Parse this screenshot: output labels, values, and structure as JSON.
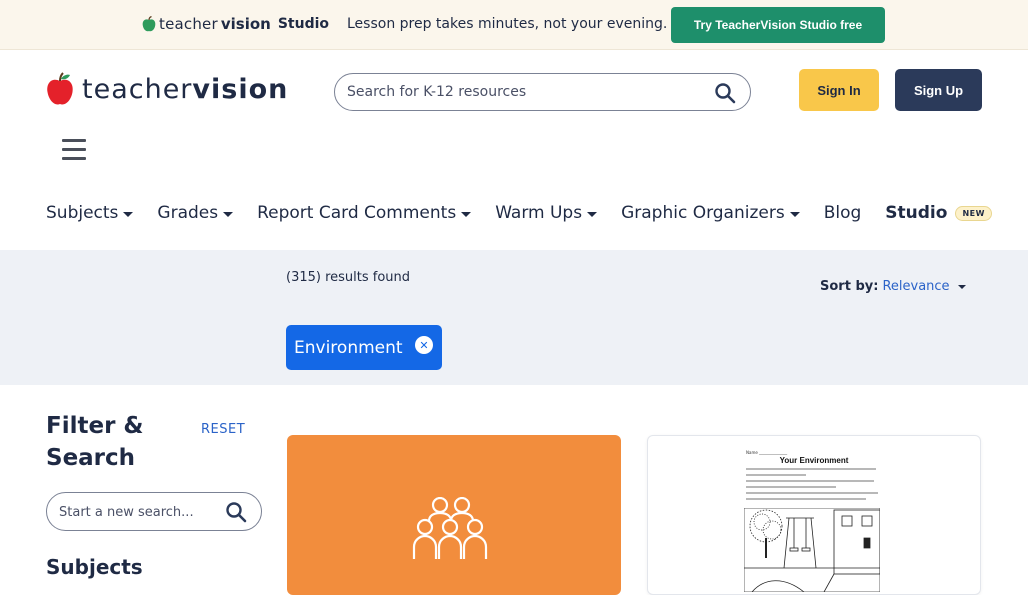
{
  "promo": {
    "logo_word1": "teacher",
    "logo_word2": "vision",
    "logo_word3": "Studio",
    "text": "Lesson prep takes minutes, not your evening.",
    "cta_label": "Try TeacherVision Studio free"
  },
  "header": {
    "logo_word1": "teacher",
    "logo_word2": "vision",
    "search_placeholder": "Search for K-12 resources",
    "signin_label": "Sign In",
    "signup_label": "Sign Up"
  },
  "nav": {
    "items": [
      {
        "label": "Subjects"
      },
      {
        "label": "Grades"
      },
      {
        "label": "Report Card Comments"
      },
      {
        "label": "Warm Ups"
      },
      {
        "label": "Graphic Organizers"
      },
      {
        "label": "Blog"
      },
      {
        "label": "Studio"
      }
    ],
    "badge": "NEW"
  },
  "results": {
    "count_text": "(315) results found",
    "sort_label": "Sort by:",
    "sort_value": "Relevance",
    "chip_label": "Environment"
  },
  "sidebar": {
    "title": "Filter & Search",
    "reset_label": "RESET",
    "search_placeholder": "Start a new search...",
    "subjects_heading": "Subjects"
  },
  "cards": [
    {
      "icon": "group-people-icon",
      "color": "#f28d3d"
    },
    {
      "worksheet_title": "Your Environment",
      "worksheet_name_line": "Name ______________"
    }
  ],
  "colors": {
    "promo_bg": "#fbf6ec",
    "promo_cta": "#1e8f6b",
    "signin": "#f9c74a",
    "signup": "#2b3a5a",
    "chip": "#1468e6",
    "link": "#2b63c8",
    "band": "#eef1f6"
  }
}
